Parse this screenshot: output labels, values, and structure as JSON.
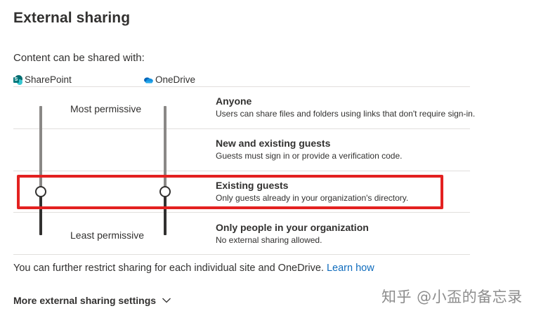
{
  "page": {
    "title": "External sharing",
    "intro": "Content can be shared with:"
  },
  "apps": {
    "sharepoint": {
      "label": "SharePoint",
      "icon": "sharepoint-icon",
      "selected_level": "Existing guests"
    },
    "onedrive": {
      "label": "OneDrive",
      "icon": "onedrive-icon",
      "selected_level": "Existing guests"
    }
  },
  "scale": {
    "top_label": "Most permissive",
    "bottom_label": "Least permissive"
  },
  "options": [
    {
      "title": "Anyone",
      "description": "Users can share files and folders using links that don't require sign-in."
    },
    {
      "title": "New and existing guests",
      "description": "Guests must sign in or provide a verification code."
    },
    {
      "title": "Existing guests",
      "description": "Only guests already in your organization's directory."
    },
    {
      "title": "Only people in your organization",
      "description": "No external sharing allowed."
    }
  ],
  "footer": {
    "text": "You can further restrict sharing for each individual site and OneDrive.",
    "link": "Learn how"
  },
  "more_settings": {
    "label": "More external sharing settings",
    "icon": "chevron-down-icon"
  },
  "watermark": "知乎 @小盃的备忘录",
  "colors": {
    "accent_link": "#0f6cbd",
    "highlight": "#e32120",
    "text": "#323130",
    "track_light": "#8a8886",
    "track_dark": "#323130"
  }
}
